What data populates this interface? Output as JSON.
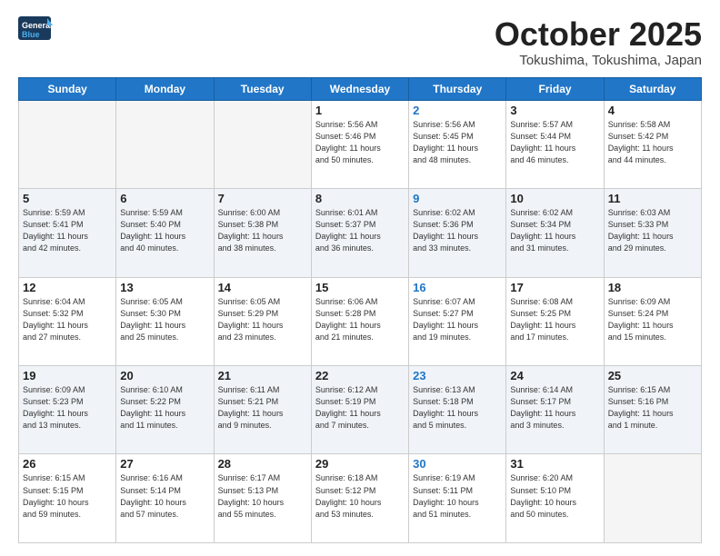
{
  "header": {
    "logo_general": "General",
    "logo_blue": "Blue",
    "month_title": "October 2025",
    "location": "Tokushima, Tokushima, Japan"
  },
  "weekdays": [
    "Sunday",
    "Monday",
    "Tuesday",
    "Wednesday",
    "Thursday",
    "Friday",
    "Saturday"
  ],
  "weeks": [
    [
      {
        "day": "",
        "info": ""
      },
      {
        "day": "",
        "info": ""
      },
      {
        "day": "",
        "info": ""
      },
      {
        "day": "1",
        "info": "Sunrise: 5:56 AM\nSunset: 5:46 PM\nDaylight: 11 hours\nand 50 minutes."
      },
      {
        "day": "2",
        "info": "Sunrise: 5:56 AM\nSunset: 5:45 PM\nDaylight: 11 hours\nand 48 minutes.",
        "thursday": true
      },
      {
        "day": "3",
        "info": "Sunrise: 5:57 AM\nSunset: 5:44 PM\nDaylight: 11 hours\nand 46 minutes."
      },
      {
        "day": "4",
        "info": "Sunrise: 5:58 AM\nSunset: 5:42 PM\nDaylight: 11 hours\nand 44 minutes."
      }
    ],
    [
      {
        "day": "5",
        "info": "Sunrise: 5:59 AM\nSunset: 5:41 PM\nDaylight: 11 hours\nand 42 minutes."
      },
      {
        "day": "6",
        "info": "Sunrise: 5:59 AM\nSunset: 5:40 PM\nDaylight: 11 hours\nand 40 minutes."
      },
      {
        "day": "7",
        "info": "Sunrise: 6:00 AM\nSunset: 5:38 PM\nDaylight: 11 hours\nand 38 minutes."
      },
      {
        "day": "8",
        "info": "Sunrise: 6:01 AM\nSunset: 5:37 PM\nDaylight: 11 hours\nand 36 minutes."
      },
      {
        "day": "9",
        "info": "Sunrise: 6:02 AM\nSunset: 5:36 PM\nDaylight: 11 hours\nand 33 minutes.",
        "thursday": true
      },
      {
        "day": "10",
        "info": "Sunrise: 6:02 AM\nSunset: 5:34 PM\nDaylight: 11 hours\nand 31 minutes."
      },
      {
        "day": "11",
        "info": "Sunrise: 6:03 AM\nSunset: 5:33 PM\nDaylight: 11 hours\nand 29 minutes."
      }
    ],
    [
      {
        "day": "12",
        "info": "Sunrise: 6:04 AM\nSunset: 5:32 PM\nDaylight: 11 hours\nand 27 minutes."
      },
      {
        "day": "13",
        "info": "Sunrise: 6:05 AM\nSunset: 5:30 PM\nDaylight: 11 hours\nand 25 minutes."
      },
      {
        "day": "14",
        "info": "Sunrise: 6:05 AM\nSunset: 5:29 PM\nDaylight: 11 hours\nand 23 minutes."
      },
      {
        "day": "15",
        "info": "Sunrise: 6:06 AM\nSunset: 5:28 PM\nDaylight: 11 hours\nand 21 minutes."
      },
      {
        "day": "16",
        "info": "Sunrise: 6:07 AM\nSunset: 5:27 PM\nDaylight: 11 hours\nand 19 minutes.",
        "thursday": true
      },
      {
        "day": "17",
        "info": "Sunrise: 6:08 AM\nSunset: 5:25 PM\nDaylight: 11 hours\nand 17 minutes."
      },
      {
        "day": "18",
        "info": "Sunrise: 6:09 AM\nSunset: 5:24 PM\nDaylight: 11 hours\nand 15 minutes."
      }
    ],
    [
      {
        "day": "19",
        "info": "Sunrise: 6:09 AM\nSunset: 5:23 PM\nDaylight: 11 hours\nand 13 minutes."
      },
      {
        "day": "20",
        "info": "Sunrise: 6:10 AM\nSunset: 5:22 PM\nDaylight: 11 hours\nand 11 minutes."
      },
      {
        "day": "21",
        "info": "Sunrise: 6:11 AM\nSunset: 5:21 PM\nDaylight: 11 hours\nand 9 minutes."
      },
      {
        "day": "22",
        "info": "Sunrise: 6:12 AM\nSunset: 5:19 PM\nDaylight: 11 hours\nand 7 minutes."
      },
      {
        "day": "23",
        "info": "Sunrise: 6:13 AM\nSunset: 5:18 PM\nDaylight: 11 hours\nand 5 minutes.",
        "thursday": true
      },
      {
        "day": "24",
        "info": "Sunrise: 6:14 AM\nSunset: 5:17 PM\nDaylight: 11 hours\nand 3 minutes."
      },
      {
        "day": "25",
        "info": "Sunrise: 6:15 AM\nSunset: 5:16 PM\nDaylight: 11 hours\nand 1 minute."
      }
    ],
    [
      {
        "day": "26",
        "info": "Sunrise: 6:15 AM\nSunset: 5:15 PM\nDaylight: 10 hours\nand 59 minutes."
      },
      {
        "day": "27",
        "info": "Sunrise: 6:16 AM\nSunset: 5:14 PM\nDaylight: 10 hours\nand 57 minutes."
      },
      {
        "day": "28",
        "info": "Sunrise: 6:17 AM\nSunset: 5:13 PM\nDaylight: 10 hours\nand 55 minutes."
      },
      {
        "day": "29",
        "info": "Sunrise: 6:18 AM\nSunset: 5:12 PM\nDaylight: 10 hours\nand 53 minutes."
      },
      {
        "day": "30",
        "info": "Sunrise: 6:19 AM\nSunset: 5:11 PM\nDaylight: 10 hours\nand 51 minutes.",
        "thursday": true
      },
      {
        "day": "31",
        "info": "Sunrise: 6:20 AM\nSunset: 5:10 PM\nDaylight: 10 hours\nand 50 minutes."
      },
      {
        "day": "",
        "info": ""
      }
    ]
  ]
}
